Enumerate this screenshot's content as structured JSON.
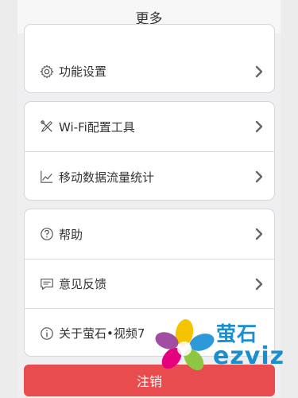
{
  "header": {
    "title": "更多"
  },
  "groups": [
    {
      "items": [
        {
          "label": "功能设置",
          "icon": "gear-icon"
        }
      ]
    },
    {
      "items": [
        {
          "label": "Wi-Fi配置工具",
          "icon": "tools-icon"
        },
        {
          "label": "移动数据流量统计",
          "icon": "line-chart-icon"
        }
      ]
    },
    {
      "items": [
        {
          "label": "帮助",
          "icon": "question-icon"
        },
        {
          "label": "意见反馈",
          "icon": "feedback-icon"
        },
        {
          "label": "关于萤石•视频7",
          "icon": "info-icon"
        }
      ]
    }
  ],
  "logout": {
    "label": "注销"
  },
  "watermark": {
    "cn": "萤石",
    "en": "ezviz"
  },
  "colors": {
    "accent_red": "#e84c4f",
    "brand_blue": "#1a8fd0"
  }
}
